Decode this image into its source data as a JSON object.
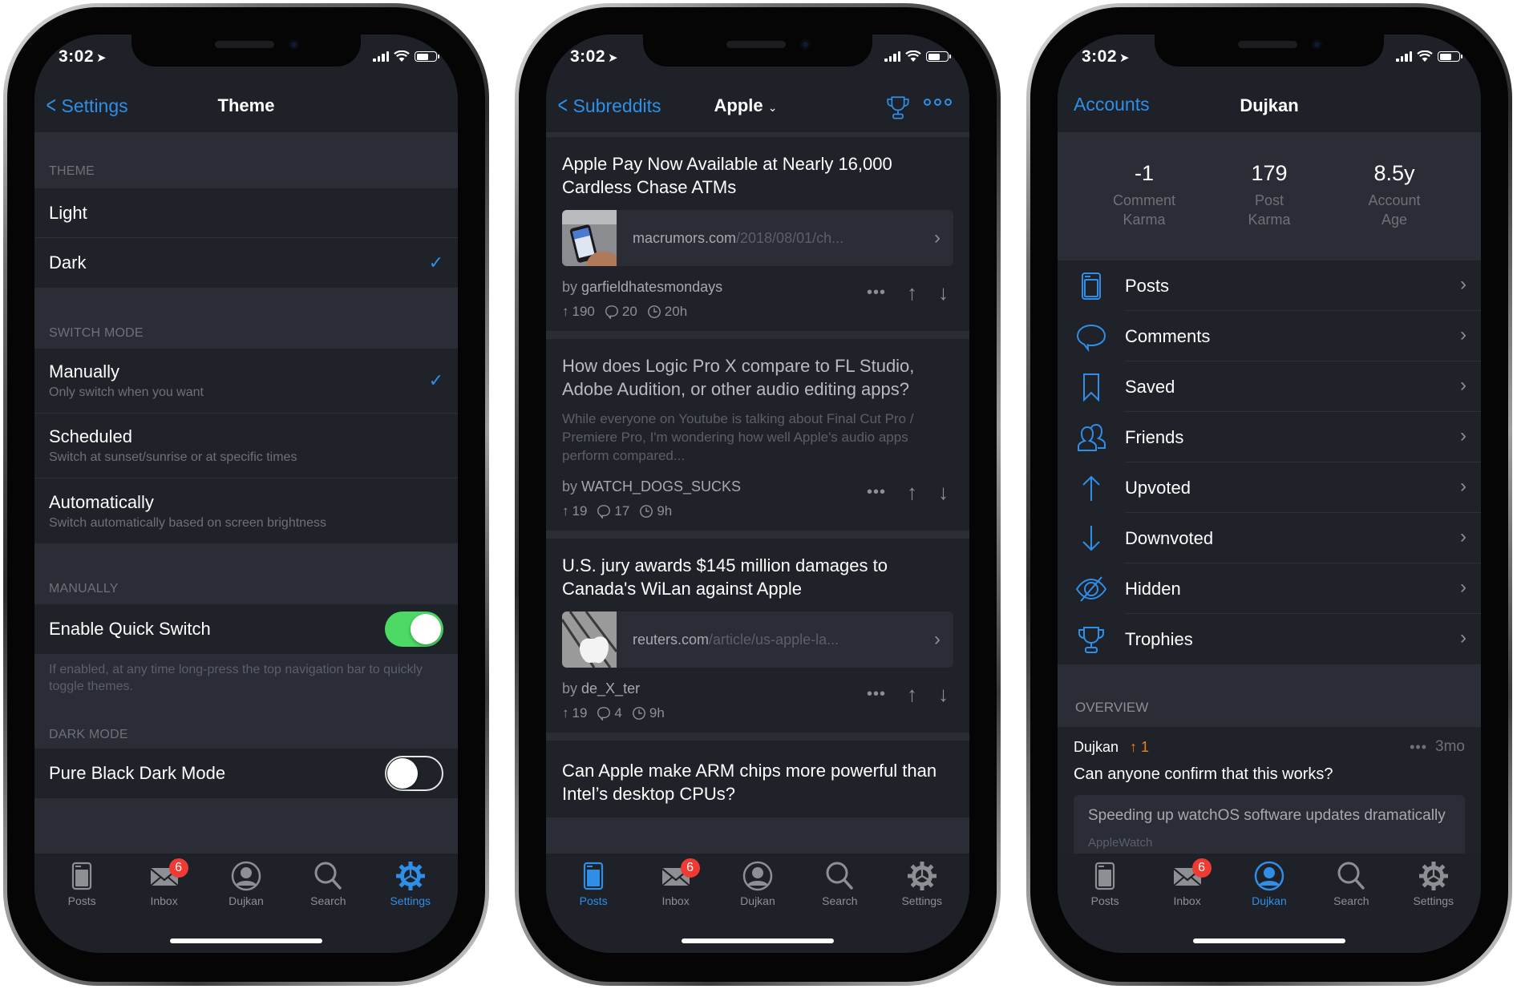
{
  "status": {
    "time": "3:02"
  },
  "tabbar": {
    "items": [
      {
        "label": "Posts",
        "icon": "posts-icon"
      },
      {
        "label": "Inbox",
        "icon": "inbox-icon",
        "badge": "6"
      },
      {
        "label": "Dujkan",
        "icon": "profile-icon"
      },
      {
        "label": "Search",
        "icon": "search-icon"
      },
      {
        "label": "Settings",
        "icon": "gear-icon"
      }
    ]
  },
  "theme_screen": {
    "back_label": "Settings",
    "title": "Theme",
    "active_tab": "Settings",
    "sections": {
      "theme": {
        "header": "THEME",
        "options": [
          {
            "label": "Light",
            "selected": false
          },
          {
            "label": "Dark",
            "selected": true
          }
        ]
      },
      "switch_mode": {
        "header": "SWITCH MODE",
        "options": [
          {
            "label": "Manually",
            "sub": "Only switch when you want",
            "selected": true
          },
          {
            "label": "Scheduled",
            "sub": "Switch at sunset/sunrise or at specific times",
            "selected": false
          },
          {
            "label": "Automatically",
            "sub": "Switch automatically based on screen brightness",
            "selected": false
          }
        ]
      },
      "manually": {
        "header": "MANUALLY",
        "toggle_label": "Enable Quick Switch",
        "toggle_on": true,
        "footer": "If enabled, at any time long-press the top navigation bar to quickly toggle themes."
      },
      "dark_mode": {
        "header": "DARK MODE",
        "toggle_label": "Pure Black Dark Mode",
        "toggle_on": false
      }
    }
  },
  "feed_screen": {
    "back_label": "Subreddits",
    "title": "Apple",
    "active_tab": "Posts",
    "posts": [
      {
        "title": "Apple Pay Now Available at Nearly 16,000 Cardless Chase ATMs",
        "link_domain": "macrumors.com",
        "link_path": "/2018/08/01/ch...",
        "author": "garfieldhatesmondays",
        "score": "190",
        "comments": "20",
        "age": "20h",
        "read": false
      },
      {
        "title": "How does Logic Pro X compare to FL Studio, Adobe Audition, or other audio editing apps?",
        "body": "While everyone on Youtube is talking about Final Cut Pro / Premiere Pro, I'm wondering how well Apple's audio apps perform compared...",
        "author": "WATCH_DOGS_SUCKS",
        "score": "19",
        "comments": "17",
        "age": "9h",
        "read": true
      },
      {
        "title": "U.S. jury awards $145 million damages to Canada's WiLan against Apple",
        "link_domain": "reuters.com",
        "link_path": "/article/us-apple-la...",
        "author": "de_X_ter",
        "score": "19",
        "comments": "4",
        "age": "9h",
        "read": false
      },
      {
        "title": "Can Apple make ARM chips more powerful than Intel’s desktop CPUs?"
      }
    ]
  },
  "profile_screen": {
    "back_label": "Accounts",
    "title": "Dujkan",
    "active_tab": "Dujkan",
    "stats": [
      {
        "value": "-1",
        "label": "Comment Karma"
      },
      {
        "value": "179",
        "label": "Post Karma"
      },
      {
        "value": "8.5y",
        "label": "Account Age"
      }
    ],
    "menu": [
      {
        "label": "Posts",
        "icon": "posts-icon"
      },
      {
        "label": "Comments",
        "icon": "comment-bubble-icon"
      },
      {
        "label": "Saved",
        "icon": "bookmark-icon"
      },
      {
        "label": "Friends",
        "icon": "friends-icon"
      },
      {
        "label": "Upvoted",
        "icon": "arrow-up-icon"
      },
      {
        "label": "Downvoted",
        "icon": "arrow-down-icon"
      },
      {
        "label": "Hidden",
        "icon": "eye-slash-icon"
      },
      {
        "label": "Trophies",
        "icon": "trophy-icon"
      }
    ],
    "overview_header": "OVERVIEW",
    "comment": {
      "author": "Dujkan",
      "score": "1",
      "age": "3mo",
      "text": "Can anyone confirm that this works?",
      "quoted_title": "Speeding up watchOS software updates dramatically",
      "quoted_subreddit": "AppleWatch"
    }
  },
  "colors": {
    "accent": "#2f8fe8",
    "toggle_on": "#4cd964",
    "badge": "#ef3b33",
    "upvote": "#f07d1e",
    "cell_bg": "#1f2229",
    "group_bg": "#2a2d35"
  }
}
